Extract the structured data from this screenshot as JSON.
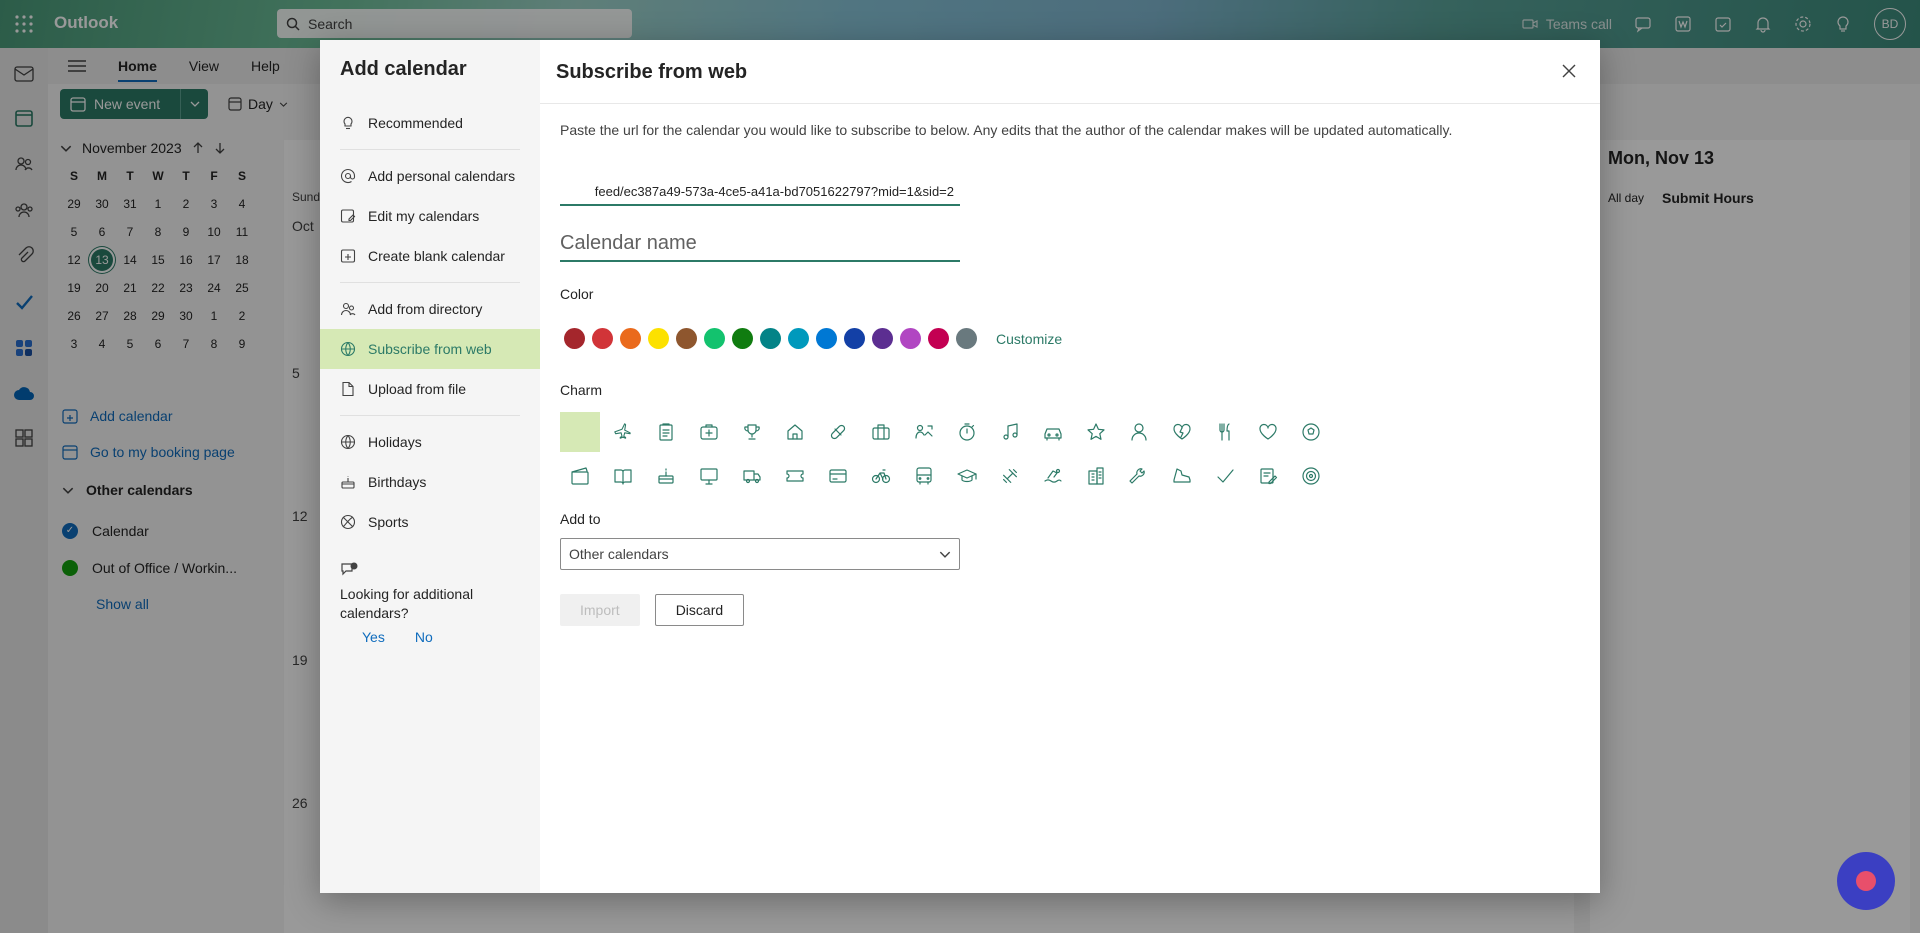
{
  "app": {
    "name": "Outlook"
  },
  "search": {
    "placeholder": "Search"
  },
  "topbar": {
    "teams_call": "Teams call",
    "avatar_initials": "BD"
  },
  "ribbon": {
    "tabs": [
      "Home",
      "View",
      "Help"
    ],
    "new_event": "New event",
    "day": "Day"
  },
  "mini_calendar": {
    "month": "November 2023",
    "dow": [
      "S",
      "M",
      "T",
      "W",
      "T",
      "F",
      "S"
    ],
    "weeks": [
      [
        "29",
        "30",
        "31",
        "1",
        "2",
        "3",
        "4"
      ],
      [
        "5",
        "6",
        "7",
        "8",
        "9",
        "10",
        "11"
      ],
      [
        "12",
        "13",
        "14",
        "15",
        "16",
        "17",
        "18"
      ],
      [
        "19",
        "20",
        "21",
        "22",
        "23",
        "24",
        "25"
      ],
      [
        "26",
        "27",
        "28",
        "29",
        "30",
        "1",
        "2"
      ],
      [
        "3",
        "4",
        "5",
        "6",
        "7",
        "8",
        "9"
      ]
    ],
    "today": "13"
  },
  "left_links": {
    "add_calendar": "Add calendar",
    "booking": "Go to my booking page"
  },
  "other_calendars": {
    "title": "Other calendars",
    "items": [
      {
        "label": "Calendar",
        "color": "#0f6cbd"
      },
      {
        "label": "Out of Office / Workin...",
        "color": "#13a10e"
      }
    ],
    "show_all": "Show all"
  },
  "cal_main": {
    "sunday": "Sund",
    "oct": "Oct",
    "weeks": [
      "5",
      "12",
      "19",
      "26"
    ]
  },
  "cal_right": {
    "date": "Mon, Nov 13",
    "all_day": "All day",
    "event": "Submit Hours"
  },
  "dialog": {
    "left_title": "Add calendar",
    "nav": [
      [
        {
          "label": "Recommended",
          "icon": "lightbulb-icon"
        }
      ],
      [
        {
          "label": "Add personal calendars",
          "icon": "at-icon"
        },
        {
          "label": "Edit my calendars",
          "icon": "edit-calendar-icon"
        },
        {
          "label": "Create blank calendar",
          "icon": "add-calendar-icon"
        }
      ],
      [
        {
          "label": "Add from directory",
          "icon": "people-icon"
        },
        {
          "label": "Subscribe from web",
          "icon": "globe-icon",
          "active": true
        },
        {
          "label": "Upload from file",
          "icon": "file-icon"
        }
      ],
      [
        {
          "label": "Holidays",
          "icon": "globe-icon"
        },
        {
          "label": "Birthdays",
          "icon": "cake-icon"
        },
        {
          "label": "Sports",
          "icon": "sports-icon"
        }
      ]
    ],
    "looking": "Looking for additional calendars?",
    "yes": "Yes",
    "no": "No",
    "right_title": "Subscribe from web",
    "description": "Paste the url for the calendar you would like to subscribe to below. Any edits that the author of the calendar makes will be updated automatically.",
    "url_value": "feed/ec387a49-573a-4ce5-a41a-bd7051622797?mid=1&sid=2",
    "name_placeholder": "Calendar name",
    "color_label": "Color",
    "colors": [
      "#a4262c",
      "#d13438",
      "#ea6a1c",
      "#fce100",
      "#8e562e",
      "#13c26e",
      "#107c10",
      "#038387",
      "#0099bc",
      "#0078d4",
      "#1340a6",
      "#5c2e91",
      "#b146c2",
      "#c30052",
      "#69797e"
    ],
    "customize": "Customize",
    "charm_label": "Charm",
    "charms": [
      "none",
      "airplane-icon",
      "clipboard-icon",
      "medical-bag-icon",
      "trophy-icon",
      "home-icon",
      "pill-icon",
      "briefcase-icon",
      "meeting-icon",
      "stopwatch-icon",
      "music-icon",
      "car-icon",
      "star-icon",
      "person-icon",
      "heart-broken-icon",
      "fork-knife-icon",
      "heart-icon",
      "soccer-ball-icon",
      "movie-icon",
      "book-icon",
      "cake-icon",
      "monitor-icon",
      "truck-icon",
      "ticket-icon",
      "credit-card-icon",
      "bicycle-icon",
      "bus-icon",
      "graduation-cap-icon",
      "dumbbell-icon",
      "swim-icon",
      "building-icon",
      "wrench-icon",
      "shoe-icon",
      "checkmark-icon",
      "note-edit-icon",
      "target-icon"
    ],
    "addto_label": "Add to",
    "addto_value": "Other calendars",
    "import": "Import",
    "discard": "Discard"
  }
}
